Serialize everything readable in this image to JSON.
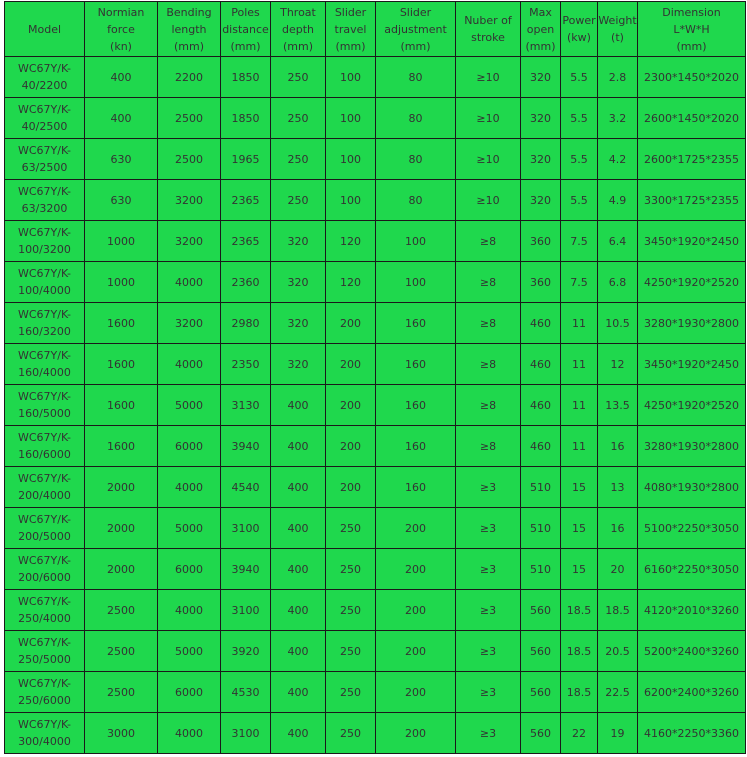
{
  "headers": [
    {
      "line1": "Model",
      "line2": "",
      "line3": ""
    },
    {
      "line1": "Normian",
      "line2": "force",
      "line3": "(kn)"
    },
    {
      "line1": "Bending",
      "line2": "length",
      "line3": "(mm)"
    },
    {
      "line1": "Poles",
      "line2": "distance",
      "line3": "(mm)"
    },
    {
      "line1": "Throat",
      "line2": "depth",
      "line3": "(mm)"
    },
    {
      "line1": "Slider",
      "line2": "travel",
      "line3": "(mm)"
    },
    {
      "line1": "Slider",
      "line2": "adjustment",
      "line3": "(mm)"
    },
    {
      "line1": "Nuber of",
      "line2": "stroke",
      "line3": ""
    },
    {
      "line1": "Max",
      "line2": "open",
      "line3": "(mm)"
    },
    {
      "line1": "Power",
      "line2": "(kw)",
      "line3": ""
    },
    {
      "line1": "Weight",
      "line2": "(t)",
      "line3": ""
    },
    {
      "line1": "Dimension",
      "line2": "L*W*H",
      "line3": "(mm)"
    }
  ],
  "rows": [
    {
      "model1": "WC67Y/K-",
      "model2": "40/2200",
      "force": "400",
      "length": "2200",
      "poles": "1850",
      "throat": "250",
      "travel": "100",
      "adjust": "80",
      "stroke": "≥10",
      "open": "320",
      "power": "5.5",
      "weight": "2.8",
      "dim": "2300*1450*2020"
    },
    {
      "model1": "WC67Y/K-",
      "model2": "40/2500",
      "force": "400",
      "length": "2500",
      "poles": "1850",
      "throat": "250",
      "travel": "100",
      "adjust": "80",
      "stroke": "≥10",
      "open": "320",
      "power": "5.5",
      "weight": "3.2",
      "dim": "2600*1450*2020"
    },
    {
      "model1": "WC67Y/K-",
      "model2": "63/2500",
      "force": "630",
      "length": "2500",
      "poles": "1965",
      "throat": "250",
      "travel": "100",
      "adjust": "80",
      "stroke": "≥10",
      "open": "320",
      "power": "5.5",
      "weight": "4.2",
      "dim": "2600*1725*2355"
    },
    {
      "model1": "WC67Y/K-",
      "model2": "63/3200",
      "force": "630",
      "length": "3200",
      "poles": "2365",
      "throat": "250",
      "travel": "100",
      "adjust": "80",
      "stroke": "≥10",
      "open": "320",
      "power": "5.5",
      "weight": "4.9",
      "dim": "3300*1725*2355"
    },
    {
      "model1": "WC67Y/K-",
      "model2": "100/3200",
      "force": "1000",
      "length": "3200",
      "poles": "2365",
      "throat": "320",
      "travel": "120",
      "adjust": "100",
      "stroke": "≥8",
      "open": "360",
      "power": "7.5",
      "weight": "6.4",
      "dim": "3450*1920*2450"
    },
    {
      "model1": "WC67Y/K-",
      "model2": "100/4000",
      "force": "1000",
      "length": "4000",
      "poles": "2360",
      "throat": "320",
      "travel": "120",
      "adjust": "100",
      "stroke": "≥8",
      "open": "360",
      "power": "7.5",
      "weight": "6.8",
      "dim": "4250*1920*2520"
    },
    {
      "model1": "WC67Y/K-",
      "model2": "160/3200",
      "force": "1600",
      "length": "3200",
      "poles": "2980",
      "throat": "320",
      "travel": "200",
      "adjust": "160",
      "stroke": "≥8",
      "open": "460",
      "power": "11",
      "weight": "10.5",
      "dim": "3280*1930*2800"
    },
    {
      "model1": "WC67Y/K-",
      "model2": "160/4000",
      "force": "1600",
      "length": "4000",
      "poles": "2350",
      "throat": "320",
      "travel": "200",
      "adjust": "160",
      "stroke": "≥8",
      "open": "460",
      "power": "11",
      "weight": "12",
      "dim": "3450*1920*2450"
    },
    {
      "model1": "WC67Y/K-",
      "model2": "160/5000",
      "force": "1600",
      "length": "5000",
      "poles": "3130",
      "throat": "400",
      "travel": "200",
      "adjust": "160",
      "stroke": "≥8",
      "open": "460",
      "power": "11",
      "weight": "13.5",
      "dim": "4250*1920*2520"
    },
    {
      "model1": "WC67Y/K-",
      "model2": "160/6000",
      "force": "1600",
      "length": "6000",
      "poles": "3940",
      "throat": "400",
      "travel": "200",
      "adjust": "160",
      "stroke": "≥8",
      "open": "460",
      "power": "11",
      "weight": "16",
      "dim": "3280*1930*2800"
    },
    {
      "model1": "WC67Y/K-",
      "model2": "200/4000",
      "force": "2000",
      "length": "4000",
      "poles": "4540",
      "throat": "400",
      "travel": "200",
      "adjust": "160",
      "stroke": "≥3",
      "open": "510",
      "power": "15",
      "weight": "13",
      "dim": "4080*1930*2800"
    },
    {
      "model1": "WC67Y/K-",
      "model2": "200/5000",
      "force": "2000",
      "length": "5000",
      "poles": "3100",
      "throat": "400",
      "travel": "250",
      "adjust": "200",
      "stroke": "≥3",
      "open": "510",
      "power": "15",
      "weight": "16",
      "dim": "5100*2250*3050"
    },
    {
      "model1": "WC67Y/K-",
      "model2": "200/6000",
      "force": "2000",
      "length": "6000",
      "poles": "3940",
      "throat": "400",
      "travel": "250",
      "adjust": "200",
      "stroke": "≥3",
      "open": "510",
      "power": "15",
      "weight": "20",
      "dim": "6160*2250*3050"
    },
    {
      "model1": "WC67Y/K-",
      "model2": "250/4000",
      "force": "2500",
      "length": "4000",
      "poles": "3100",
      "throat": "400",
      "travel": "250",
      "adjust": "200",
      "stroke": "≥3",
      "open": "560",
      "power": "18.5",
      "weight": "18.5",
      "dim": "4120*2010*3260"
    },
    {
      "model1": "WC67Y/K-",
      "model2": "250/5000",
      "force": "2500",
      "length": "5000",
      "poles": "3920",
      "throat": "400",
      "travel": "250",
      "adjust": "200",
      "stroke": "≥3",
      "open": "560",
      "power": "18.5",
      "weight": "20.5",
      "dim": "5200*2400*3260"
    },
    {
      "model1": "WC67Y/K-",
      "model2": "250/6000",
      "force": "2500",
      "length": "6000",
      "poles": "4530",
      "throat": "400",
      "travel": "250",
      "adjust": "200",
      "stroke": "≥3",
      "open": "560",
      "power": "18.5",
      "weight": "22.5",
      "dim": "6200*2400*3260"
    },
    {
      "model1": "WC67Y/K-",
      "model2": "300/4000",
      "force": "3000",
      "length": "4000",
      "poles": "3100",
      "throat": "400",
      "travel": "250",
      "adjust": "200",
      "stroke": "≥3",
      "open": "560",
      "power": "22",
      "weight": "19",
      "dim": "4160*2250*3360"
    }
  ]
}
